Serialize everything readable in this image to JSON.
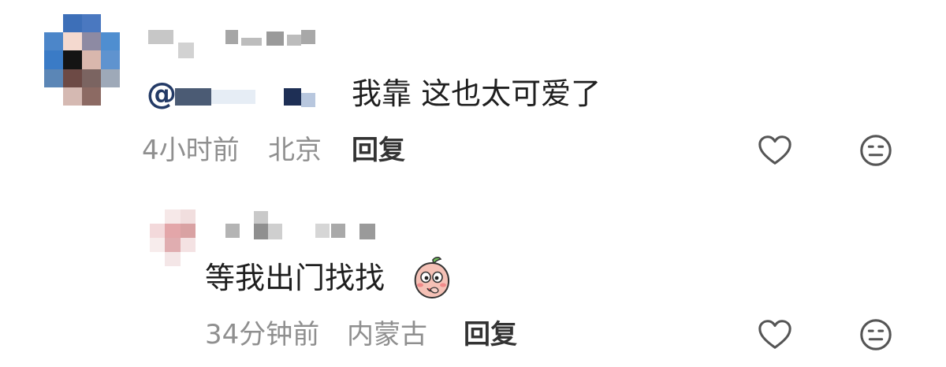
{
  "comments": [
    {
      "mention_symbol": "@",
      "text": "我靠 这也太可爱了",
      "time": "4小时前",
      "location": "北京",
      "reply_label": "回复",
      "like_icon": "heart-outline-icon",
      "dislike_icon": "meh-face-icon"
    },
    {
      "text": "等我出门找找",
      "emoji": "peach-sticker-icon",
      "time": "34分钟前",
      "location": "内蒙古",
      "reply_label": "回复",
      "like_icon": "heart-outline-icon",
      "dislike_icon": "meh-face-icon"
    }
  ],
  "colors": {
    "text": "#1f1f1f",
    "meta": "#8f8f8f",
    "icon": "#555555",
    "mention": "#2b3f6b"
  }
}
